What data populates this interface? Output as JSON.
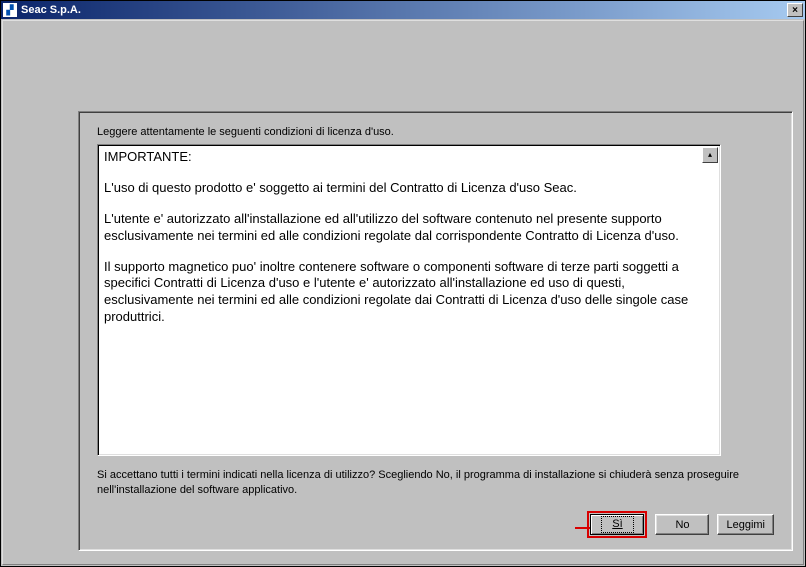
{
  "window": {
    "title": "Seac S.p.A.",
    "close_btn_label": "×"
  },
  "panel": {
    "instruction": "Leggere attentamente le seguenti condizioni di licenza d'uso.",
    "license": {
      "heading": "IMPORTANTE:",
      "p1": "L'uso di questo prodotto e' soggetto ai termini del Contratto di Licenza d'uso Seac.",
      "p2": "L'utente e' autorizzato all'installazione ed all'utilizzo del software contenuto nel presente supporto esclusivamente nei termini ed alle condizioni regolate dal corrispondente Contratto di Licenza d'uso.",
      "p3": "Il supporto magnetico puo' inoltre contenere software o componenti software di terze parti soggetti a specifici Contratti di Licenza d'uso e l'utente e' autorizzato all'installazione ed uso di questi, esclusivamente nei termini ed alle condizioni regolate dai Contratti di Licenza d'uso delle singole case  produttrici."
    },
    "accept_q": "Si accettano tutti i termini indicati nella licenza di utilizzo?     Scegliendo No,    il programma di installazione si chiuderà senza proseguire nell'installazione del software applicativo.",
    "buttons": {
      "yes": "Sì",
      "no": "No",
      "readme": "Leggimi"
    }
  }
}
